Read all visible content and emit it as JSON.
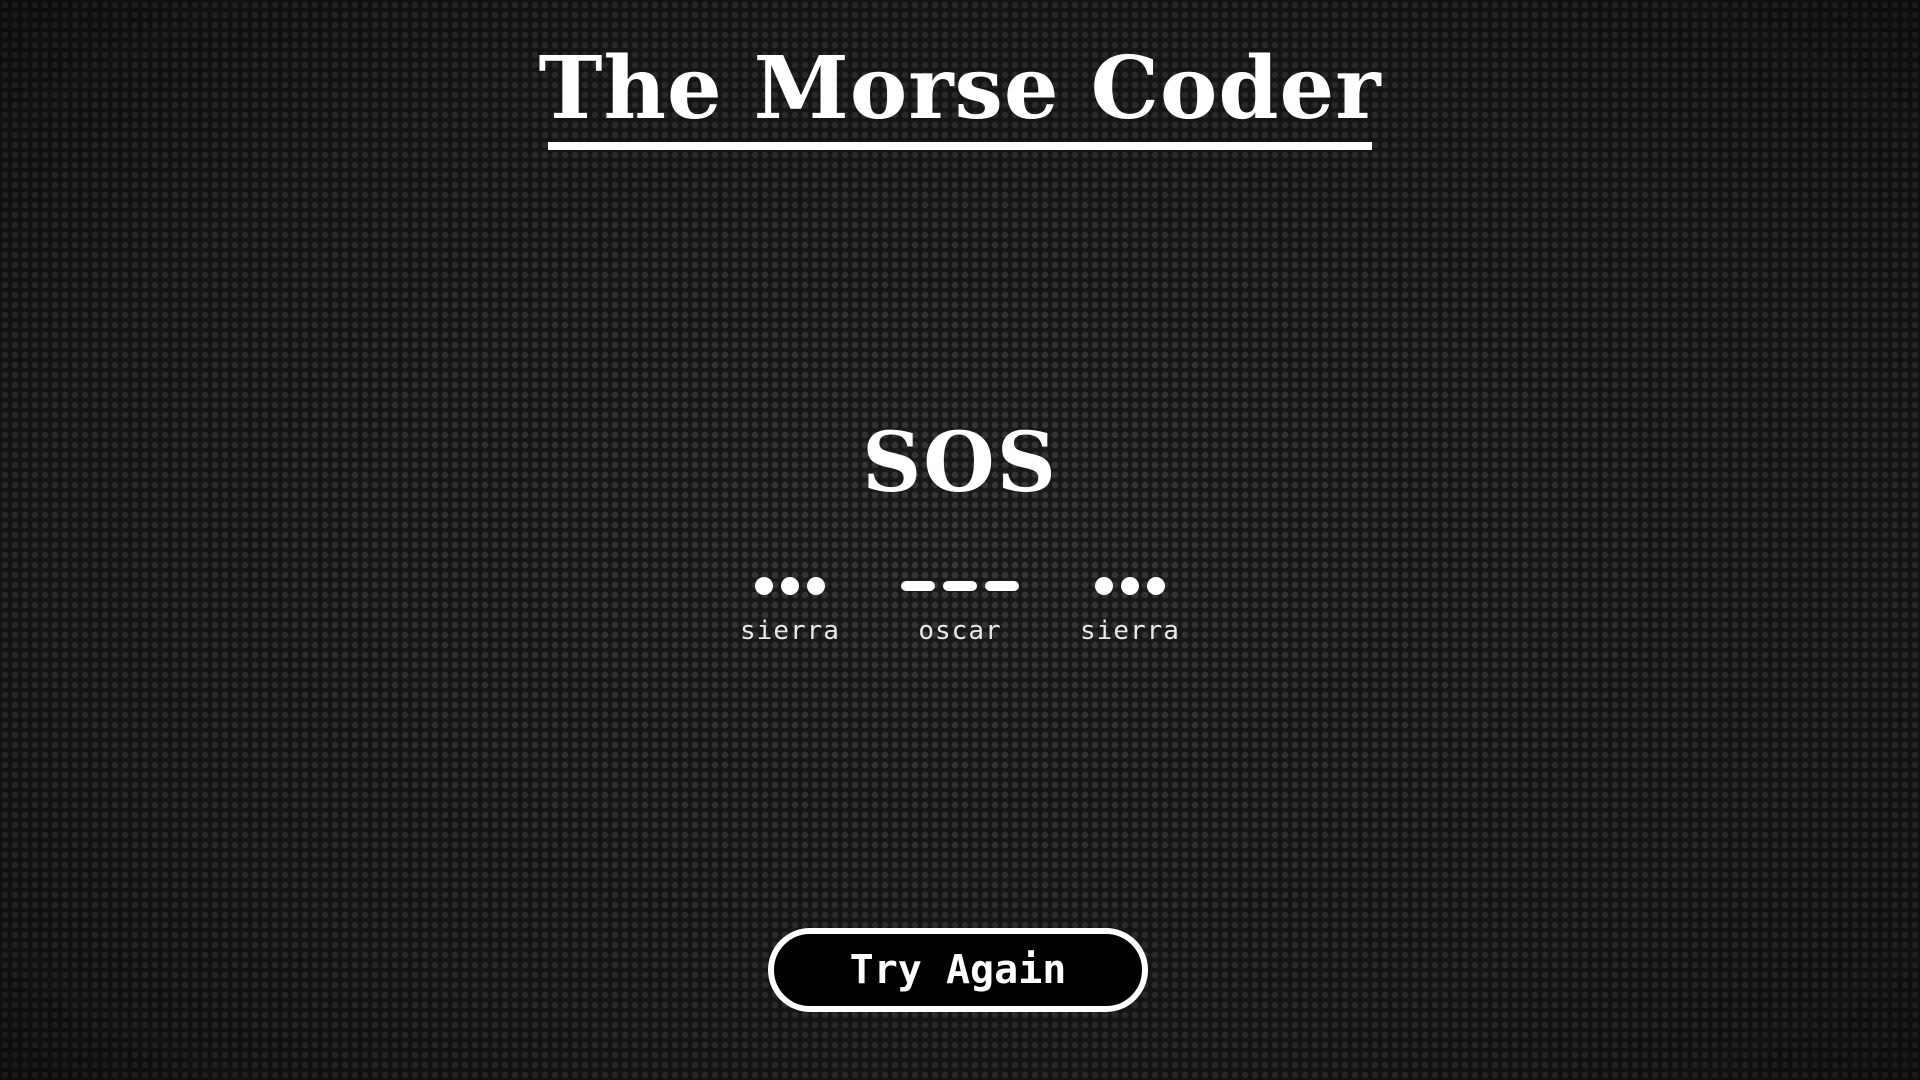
{
  "header": {
    "title": "The Morse Coder"
  },
  "result": {
    "word": "SOS",
    "letters": [
      {
        "phonetic": "sierra",
        "symbols": [
          "dot",
          "dot",
          "dot"
        ]
      },
      {
        "phonetic": "oscar",
        "symbols": [
          "dash",
          "dash",
          "dash"
        ]
      },
      {
        "phonetic": "sierra",
        "symbols": [
          "dot",
          "dot",
          "dot"
        ]
      }
    ]
  },
  "actions": {
    "try_again_label": "Try Again"
  },
  "colors": {
    "background": "#141414",
    "foreground": "#ffffff",
    "button_fill": "#000000"
  }
}
